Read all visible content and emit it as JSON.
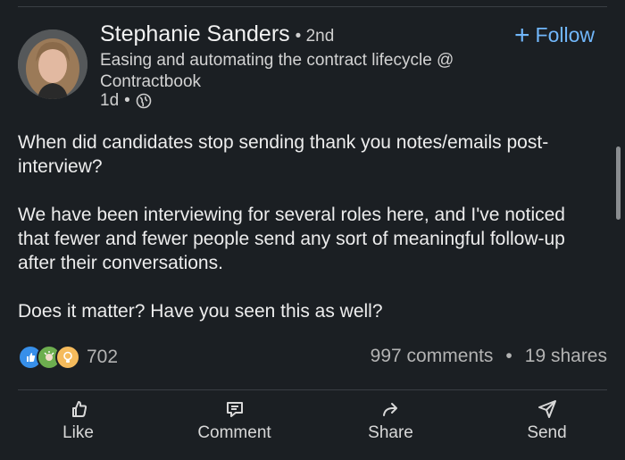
{
  "author": {
    "name": "Stephanie Sanders",
    "degree": "• 2nd",
    "headline": "Easing and automating the contract lifecycle @ Contractbook",
    "time": "1d",
    "dot": "•",
    "visibility_icon": "globe-icon"
  },
  "follow": {
    "plus": "+",
    "label": "Follow"
  },
  "post": {
    "paragraphs": [
      "When did candidates stop sending thank you notes/emails post-interview?",
      "We have been interviewing for several roles here, and I've noticed that fewer and fewer people send any sort of meaningful follow-up after their conversations.",
      "Does it matter? Have you seen this as well?"
    ]
  },
  "engagement": {
    "reaction_icons": [
      "like-icon",
      "celebrate-icon",
      "insightful-icon"
    ],
    "reaction_count": "702",
    "comments": "997 comments",
    "separator": "•",
    "shares": "19 shares"
  },
  "actions": [
    {
      "label": "Like",
      "icon": "thumbs-up-icon"
    },
    {
      "label": "Comment",
      "icon": "comment-icon"
    },
    {
      "label": "Share",
      "icon": "share-arrow-icon"
    },
    {
      "label": "Send",
      "icon": "send-icon"
    }
  ],
  "colors": {
    "background": "#1b1f23",
    "accent": "#71b7fb",
    "like": "#378fe9",
    "celebrate": "#6dae4f",
    "insightful": "#f5bb5c"
  }
}
